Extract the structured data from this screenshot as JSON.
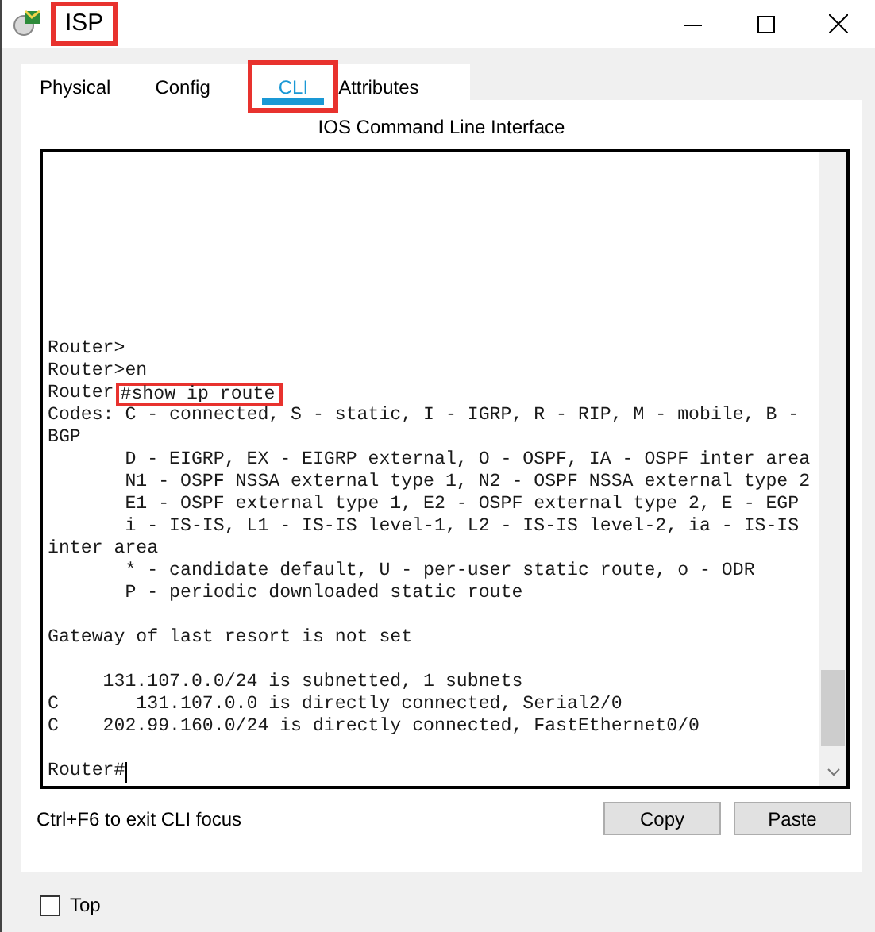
{
  "window": {
    "title": "ISP",
    "highlighted": true
  },
  "tabs": [
    {
      "label": "Physical",
      "selected": false,
      "highlighted": false
    },
    {
      "label": "Config",
      "selected": false,
      "highlighted": false
    },
    {
      "label": "CLI",
      "selected": true,
      "highlighted": true
    },
    {
      "label": "Attributes",
      "selected": false,
      "highlighted": false
    }
  ],
  "cli": {
    "heading": "IOS Command Line Interface",
    "blocks": [
      [
        {
          "kind": "output",
          "text": "Router>"
        },
        {
          "kind": "output",
          "text": "Router>en"
        },
        {
          "kind": "command",
          "prompt": "Router",
          "command": "#show ip route",
          "highlighted": true
        },
        {
          "kind": "output",
          "text": "Codes: C - connected, S - static, I - IGRP, R - RIP, M - mobile, B -"
        },
        {
          "kind": "output",
          "text": "BGP"
        },
        {
          "kind": "output",
          "text": "       D - EIGRP, EX - EIGRP external, O - OSPF, IA - OSPF inter area"
        },
        {
          "kind": "output",
          "text": "       N1 - OSPF NSSA external type 1, N2 - OSPF NSSA external type 2"
        },
        {
          "kind": "output",
          "text": "       E1 - OSPF external type 1, E2 - OSPF external type 2, E - EGP"
        },
        {
          "kind": "output",
          "text": "       i - IS-IS, L1 - IS-IS level-1, L2 - IS-IS level-2, ia - IS-IS"
        },
        {
          "kind": "output",
          "text": "inter area"
        },
        {
          "kind": "output",
          "text": "       * - candidate default, U - per-user static route, o - ODR"
        },
        {
          "kind": "output",
          "text": "       P - periodic downloaded static route"
        }
      ],
      [
        {
          "kind": "output",
          "text": "Gateway of last resort is not set"
        }
      ],
      [
        {
          "kind": "output",
          "text": "     131.107.0.0/24 is subnetted, 1 subnets"
        },
        {
          "kind": "output",
          "text": "C       131.107.0.0 is directly connected, Serial2/0"
        },
        {
          "kind": "output",
          "text": "C    202.99.160.0/24 is directly connected, FastEthernet0/0"
        }
      ],
      [
        {
          "kind": "prompt",
          "text": "Router#"
        }
      ]
    ]
  },
  "hint": "Ctrl+F6 to exit CLI focus",
  "buttons": [
    "Copy",
    "Paste"
  ],
  "top_option": {
    "label": "Top",
    "checked": false
  }
}
